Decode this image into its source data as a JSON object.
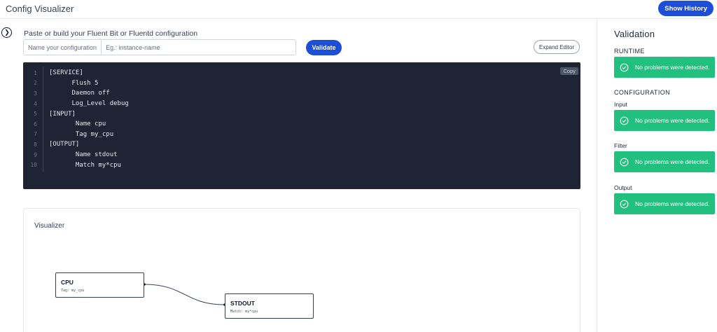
{
  "header": {
    "title": "Config Visualizer",
    "show_history_label": "Show History"
  },
  "editor_panel": {
    "prompt": "Paste or build your Fluent Bit or Fluentd configuration",
    "name_label": "Name your configuration",
    "name_placeholder": "Eg.: instance-name",
    "validate_label": "Validate",
    "expand_label": "Expand Editor",
    "copy_label": "Copy",
    "code_lines": [
      {
        "num": "1",
        "text": "[SERVICE]"
      },
      {
        "num": "2",
        "text": "      Flush 5"
      },
      {
        "num": "3",
        "text": "      Daemon off"
      },
      {
        "num": "4",
        "text": "      Log_Level debug"
      },
      {
        "num": "5",
        "text": "[INPUT]"
      },
      {
        "num": "6",
        "text": "       Name cpu"
      },
      {
        "num": "7",
        "text": "       Tag my_cpu"
      },
      {
        "num": "8",
        "text": "[OUTPUT]"
      },
      {
        "num": "9",
        "text": "       Name stdout"
      },
      {
        "num": "10",
        "text": "       Match my*cpu"
      }
    ]
  },
  "visualizer": {
    "title": "Visualizer",
    "nodes": [
      {
        "title": "CPU",
        "subtitle": "Tag: my_cpu"
      },
      {
        "title": "STDOUT",
        "subtitle": "Match: my*cpu"
      }
    ]
  },
  "validation": {
    "title": "Validation",
    "runtime_label": "RUNTIME",
    "configuration_label": "CONFIGURATION",
    "input_label": "Input",
    "filter_label": "Filter",
    "output_label": "Output",
    "ok_message": "No problems were detected.",
    "ok_color": "#22c07f"
  },
  "icons": {
    "collapse": "chevron-right-icon",
    "status": "check-circle-icon"
  },
  "colors": {
    "primary": "#1d4ed8",
    "editor_bg": "#1e2433"
  }
}
